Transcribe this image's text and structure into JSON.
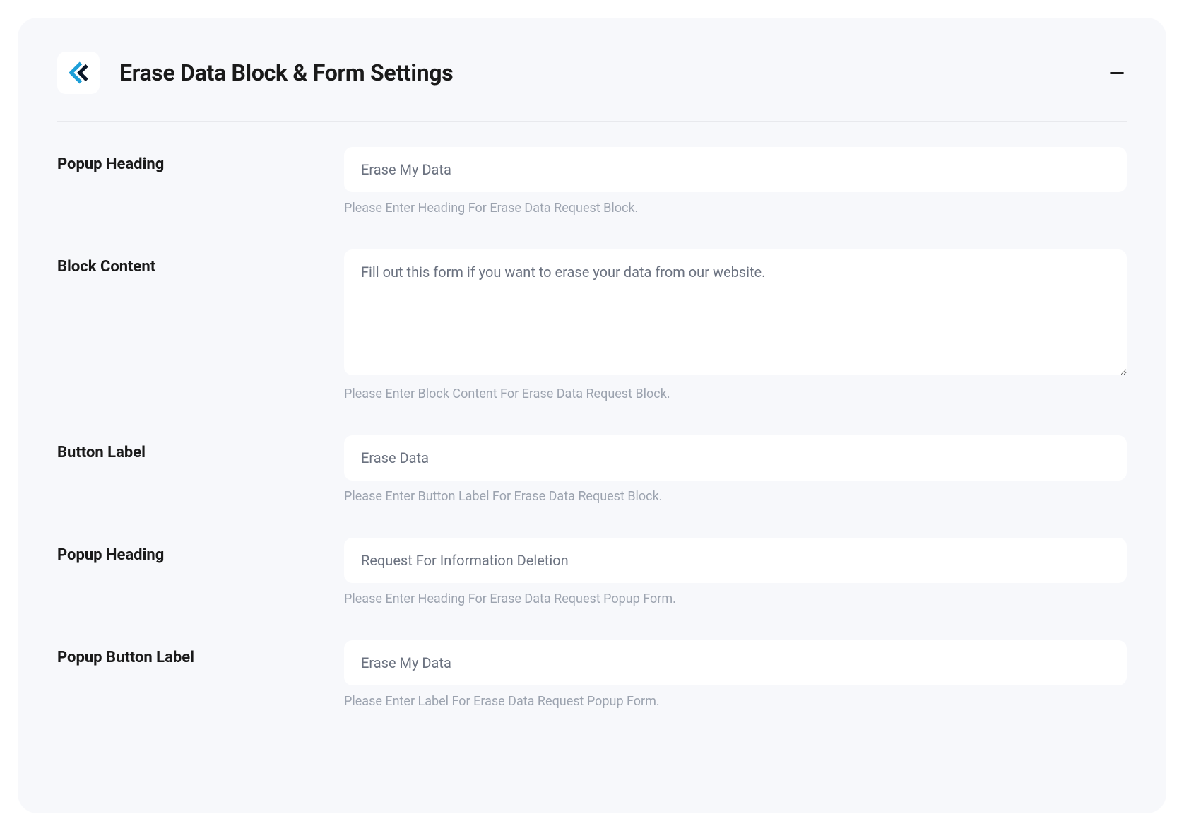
{
  "panel": {
    "title": "Erase Data Block & Form Settings"
  },
  "fields": {
    "popup_heading_1": {
      "label": "Popup Heading",
      "value": "Erase My Data",
      "help": "Please Enter Heading For Erase Data Request Block."
    },
    "block_content": {
      "label": "Block Content",
      "value": "Fill out this form if you want to erase your data from our website.",
      "help": "Please Enter Block Content For Erase Data Request Block."
    },
    "button_label": {
      "label": "Button Label",
      "value": "Erase Data",
      "help": "Please Enter Button Label For Erase Data Request Block."
    },
    "popup_heading_2": {
      "label": "Popup Heading",
      "value": "Request For Information Deletion",
      "help": "Please Enter Heading For Erase Data Request Popup Form."
    },
    "popup_button_label": {
      "label": "Popup Button Label",
      "value": "Erase My Data",
      "help": "Please Enter Label For Erase Data Request Popup Form."
    }
  }
}
